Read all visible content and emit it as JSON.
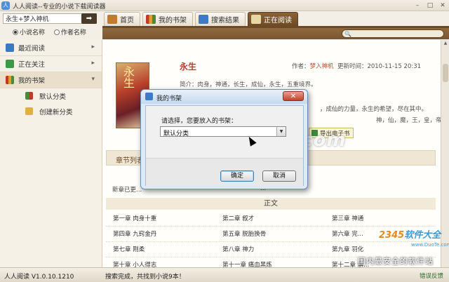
{
  "window": {
    "title": "人人阅读--专业的小说下载阅读器"
  },
  "search": {
    "value": "永生+梦入神机",
    "mode_options": [
      "小说名称",
      "作者名称"
    ],
    "mode_selected": "小说名称"
  },
  "tabs": [
    {
      "label": "首页",
      "active": false
    },
    {
      "label": "我的书架",
      "active": false
    },
    {
      "label": "搜索结果",
      "active": false
    },
    {
      "label": "正在阅读",
      "active": true
    }
  ],
  "sidebar": {
    "items": [
      {
        "label": "最近阅读",
        "arrow": "▸"
      },
      {
        "label": "正在关注",
        "arrow": "▸"
      },
      {
        "label": "我的书架",
        "arrow": "▾"
      }
    ],
    "subitems": [
      {
        "label": "默认分类"
      },
      {
        "label": "创建新分类"
      }
    ]
  },
  "book": {
    "cover_text": "永生",
    "title": "永生",
    "meta_prefix": "作者：",
    "author": "梦入神机",
    "updated": "更新时间：2010-11-15 20:31",
    "intro": "简介：肉身，神通，长生，成仙，永生，五重境界。",
    "intro_line2": "，成仙的力量，永生的希望，尽在其中。",
    "intro_line3": "神，仙，魔，王，皇，帝，人间的爱",
    "export_label": "导出电子书"
  },
  "chapters": {
    "header": "章节列表",
    "latest_prefix": "新章已更...",
    "latest_more": "...",
    "volume": "正文",
    "rows": [
      [
        "第一章  肉身十重",
        "第二章  叙才",
        "第三章  神通"
      ],
      [
        "第四章  九窍金丹",
        "第五章  脱胎换骨",
        "第六章  完..."
      ],
      [
        "第七章  刚柔",
        "第八章  神力",
        "第九章  羽化"
      ],
      [
        "第十章  小人得志",
        "第十一章  痛血黑炼",
        "第十二章  解..."
      ]
    ]
  },
  "dialog": {
    "title": "我的书架",
    "close_label": "✕",
    "prompt": "请选择，您要放入的书架：",
    "selected": "默认分类",
    "ok": "确定",
    "cancel": "取消"
  },
  "status": {
    "version": "人人阅读 V1.0.10.1210",
    "message": "搜索完成，共找到小说9本！",
    "error_report": "错误反馈"
  },
  "watermarks": {
    "duote": "www.DuoTe.com",
    "site_a": "2345",
    "site_b": "软件大全",
    "site_url": "www.DuoTe.com",
    "slogan": "国内最安全的软件站"
  },
  "colors": {
    "tab_active": "#6d4a26",
    "title_red": "#c0392b",
    "dialog_bg": "#dce9f7"
  }
}
